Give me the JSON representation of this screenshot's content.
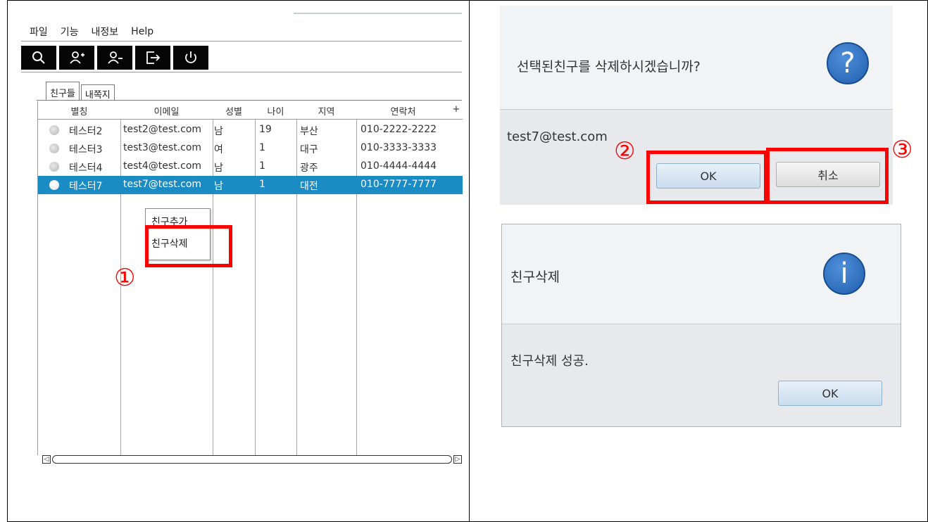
{
  "app": {
    "menu": [
      "파일",
      "기능",
      "내정보",
      "Help"
    ],
    "toolbar": [
      {
        "icon": "search-icon"
      },
      {
        "icon": "add-user-icon"
      },
      {
        "icon": "remove-user-icon"
      },
      {
        "icon": "logout-icon"
      },
      {
        "icon": "power-icon"
      }
    ],
    "tabs": [
      "친구들",
      "내쪽지"
    ],
    "columns": [
      "별칭",
      "이메일",
      "성별",
      "나이",
      "지역",
      "연락처",
      "+"
    ],
    "rows": [
      {
        "nick": "테스터2",
        "email": "test2@test.com",
        "gender": "남",
        "age": "19",
        "region": "부산",
        "phone": "010-2222-2222",
        "selected": false
      },
      {
        "nick": "테스터3",
        "email": "test3@test.com",
        "gender": "여",
        "age": "1",
        "region": "대구",
        "phone": "010-3333-3333",
        "selected": false
      },
      {
        "nick": "테스터4",
        "email": "test4@test.com",
        "gender": "남",
        "age": "1",
        "region": "광주",
        "phone": "010-4444-4444",
        "selected": false
      },
      {
        "nick": "테스터7",
        "email": "test7@test.com",
        "gender": "남",
        "age": "1",
        "region": "대전",
        "phone": "010-7777-7777",
        "selected": true
      }
    ],
    "context_menu": [
      "친구추가",
      "친구삭제"
    ],
    "scroll_arrows": [
      "◁",
      "▷"
    ]
  },
  "markers": [
    "①",
    "②",
    "③"
  ],
  "confirm_dialog": {
    "question": "선택된친구를 삭제하시겠습니까?",
    "icon": "?",
    "email": "test7@test.com",
    "ok": "OK",
    "cancel": "취소"
  },
  "info_dialog": {
    "title": "친구삭제",
    "icon": "i",
    "message": "친구삭제 성공.",
    "ok": "OK"
  },
  "colors": {
    "selection": "#1b8bc4",
    "highlight": "#ff0000",
    "dialog_bg": "#e7e9ec",
    "icon_blue": "#2f6fc0"
  }
}
